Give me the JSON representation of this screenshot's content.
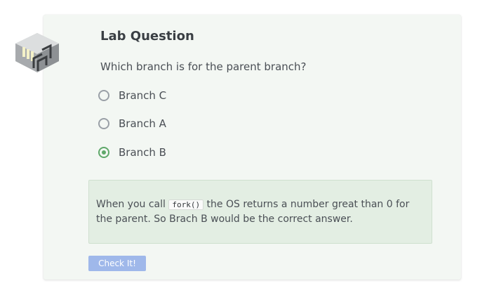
{
  "lab": {
    "title": "Lab Question",
    "icon": "lab-building-icon",
    "question": "Which branch is for the parent branch?"
  },
  "options": [
    {
      "label": "Branch C",
      "selected": false
    },
    {
      "label": "Branch A",
      "selected": false
    },
    {
      "label": "Branch B",
      "selected": true
    }
  ],
  "feedback": {
    "text_before": "When you call",
    "code": "fork()",
    "text_after": "the OS returns a number great than 0 for the parent. So Brach B would be the correct answer."
  },
  "check_button": {
    "label": "Check It!"
  },
  "colors": {
    "accent": "#5fa86a",
    "button": "#9fb8ea",
    "card_bg": "#f3f7f3",
    "feedback_bg": "#e3eee3"
  }
}
